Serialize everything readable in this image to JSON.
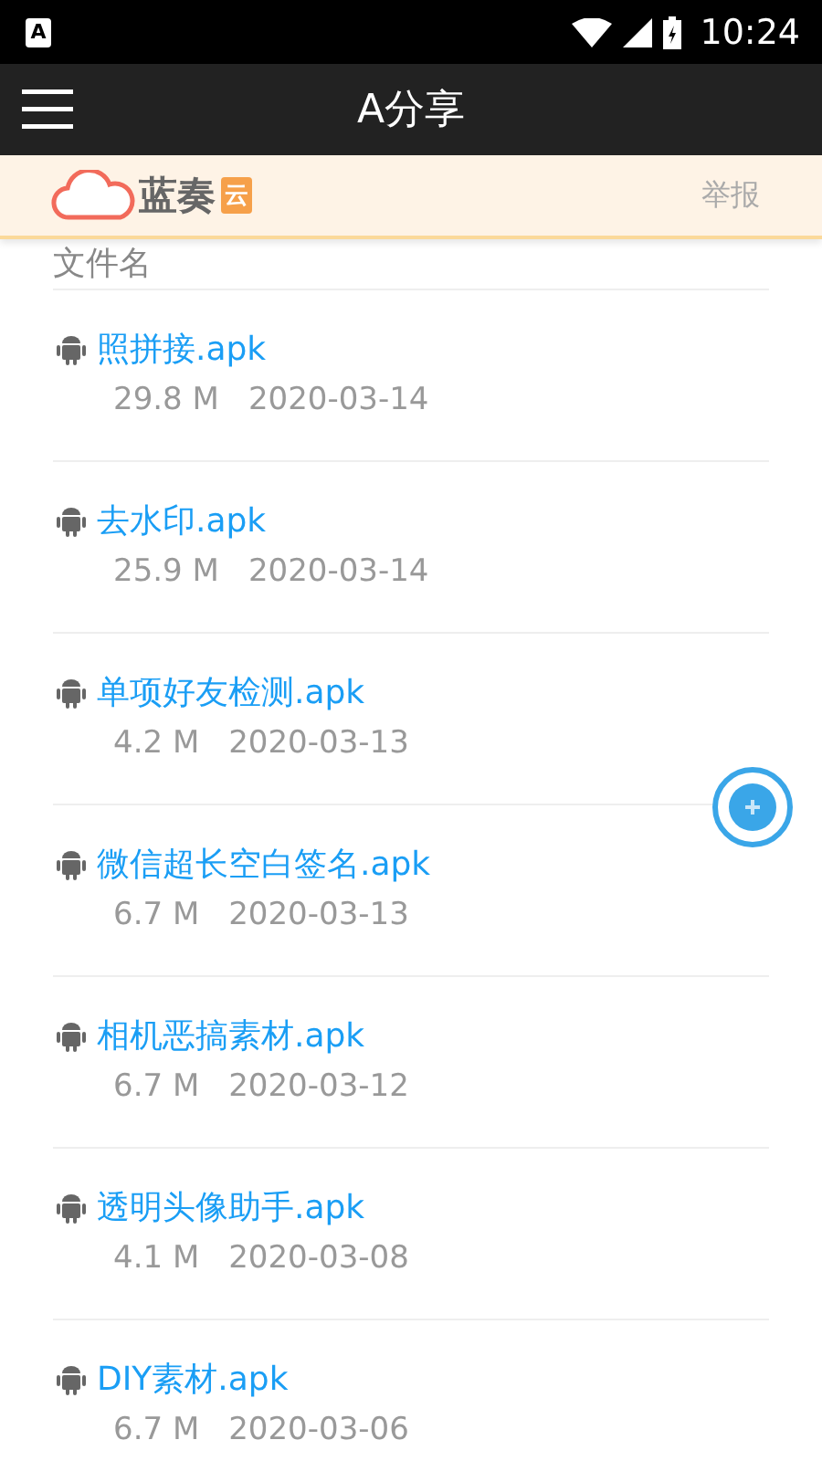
{
  "status_bar": {
    "time": "10:24",
    "app_badge": "A"
  },
  "app_bar": {
    "title": "A分享"
  },
  "banner": {
    "logo_text": "蓝奏",
    "logo_badge": "云",
    "report": "举报"
  },
  "list_header": "文件名",
  "files": [
    {
      "name": "照拼接.apk",
      "size": "29.8 M",
      "date": "2020-03-14"
    },
    {
      "name": "去水印.apk",
      "size": "25.9 M",
      "date": "2020-03-14"
    },
    {
      "name": "单项好友检测.apk",
      "size": "4.2 M",
      "date": "2020-03-13"
    },
    {
      "name": "微信超长空白签名.apk",
      "size": "6.7 M",
      "date": "2020-03-13"
    },
    {
      "name": "相机恶搞素材.apk",
      "size": "6.7 M",
      "date": "2020-03-12"
    },
    {
      "name": "透明头像助手.apk",
      "size": "4.1 M",
      "date": "2020-03-08"
    },
    {
      "name": "DIY素材.apk",
      "size": "6.7 M",
      "date": "2020-03-06"
    }
  ]
}
